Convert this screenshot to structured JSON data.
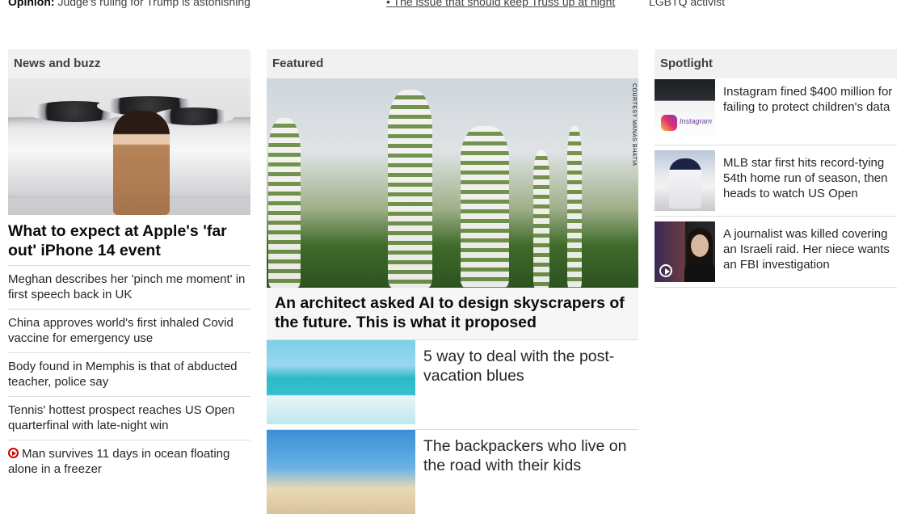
{
  "top_row": {
    "col1_prefix": "Opinion:",
    "col1_text": "Judge's ruling for Trump is astonishing",
    "col2_text": "• The issue that should keep Truss up at night",
    "col3_text": "LGBTQ activist"
  },
  "news_and_buzz": {
    "heading": "News and buzz",
    "lead_headline": "What to expect at Apple's 'far out' iPhone 14 event",
    "items": [
      {
        "text": "Meghan describes her 'pinch me moment' in first speech back in UK"
      },
      {
        "text": "China approves world's first inhaled Covid vaccine for emergency use"
      },
      {
        "text": "Body found in Memphis is that of abducted teacher, police say"
      },
      {
        "text": "Tennis' hottest prospect reaches US Open quarterfinal with late-night win"
      },
      {
        "text": "Man survives 11 days in ocean floating alone in a freezer",
        "icon": "play-icon"
      }
    ]
  },
  "featured": {
    "heading": "Featured",
    "image_credit": "COURTESY MANAS BHATIA",
    "lead_caption": "An architect asked AI to design skyscrapers of the future. This is what it proposed",
    "stories": [
      {
        "text": "5 way to deal with the post-vacation blues"
      },
      {
        "text": "The backpackers who live on the road with their kids"
      }
    ]
  },
  "spotlight": {
    "heading": "Spotlight",
    "items": [
      {
        "text": "Instagram fined $400 million for failing to protect children's data",
        "thumb_label": "Instagram"
      },
      {
        "text": "MLB star first hits record-tying 54th home run of season, then heads to watch US Open"
      },
      {
        "text": "A journalist was killed covering an Israeli raid. Her niece wants an FBI investigation",
        "icon": "play-icon"
      }
    ]
  },
  "colors": {
    "section_head_bg": "#f1f1f1",
    "divider": "#dcdcdc",
    "video_icon_red": "#cc0000"
  }
}
